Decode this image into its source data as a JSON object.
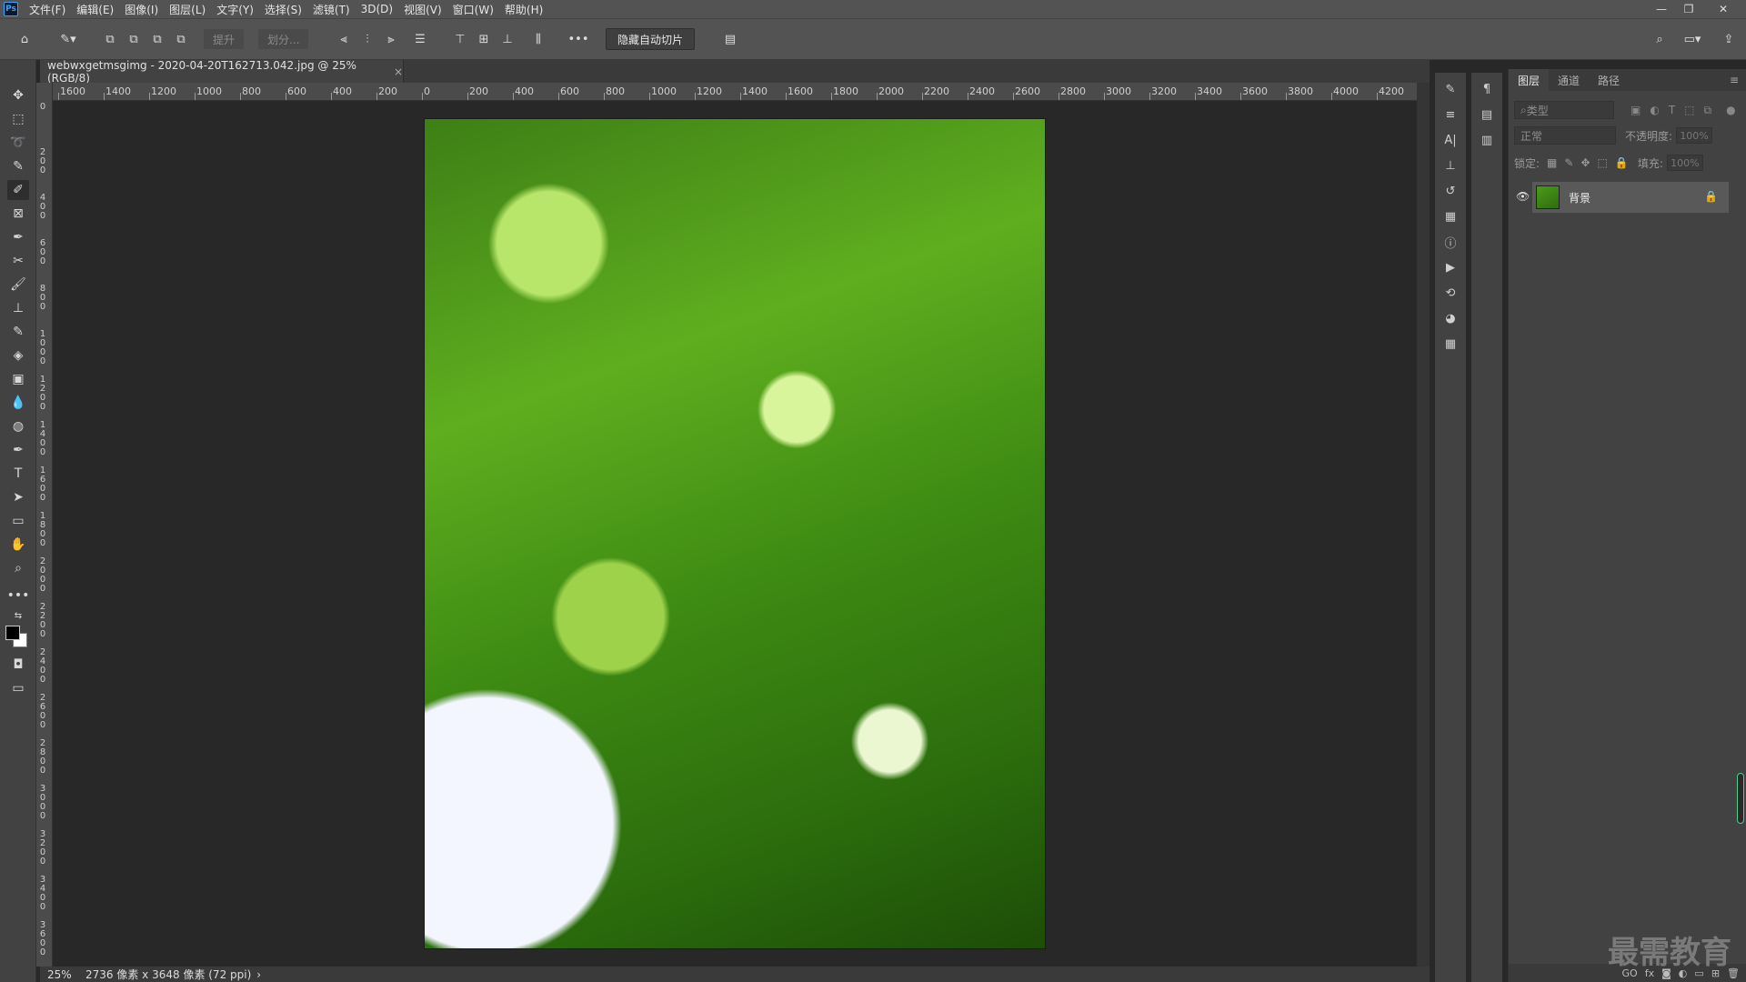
{
  "app": {
    "logo": "Ps"
  },
  "menu": [
    "文件(F)",
    "编辑(E)",
    "图像(I)",
    "图层(L)",
    "文字(Y)",
    "选择(S)",
    "滤镜(T)",
    "3D(D)",
    "视图(V)",
    "窗口(W)",
    "帮助(H)"
  ],
  "options_bar": {
    "lift_label": "提升",
    "divide_label": "划分...",
    "more_label": "•••",
    "hide_auto_slices_label": "隐藏自动切片"
  },
  "document": {
    "tab_title": "webwxgetmsgimg - 2020-04-20T162713.042.jpg @ 25%(RGB/8)",
    "close": "×"
  },
  "ruler": {
    "h_labels": [
      "1600",
      "1400",
      "1200",
      "1000",
      "800",
      "600",
      "400",
      "200",
      "0",
      "200",
      "400",
      "600",
      "800",
      "1000",
      "1200",
      "1400",
      "1600",
      "1800",
      "2000",
      "2200",
      "2400",
      "2600",
      "2800",
      "3000",
      "3200",
      "3400",
      "3600",
      "3800",
      "4000",
      "4200"
    ],
    "v_labels": [
      "0",
      "200",
      "400",
      "600",
      "800",
      "1000",
      "1200",
      "1400",
      "1600",
      "1800",
      "2000",
      "2200",
      "2400",
      "2600",
      "2800",
      "3000",
      "3200",
      "3400",
      "3600"
    ]
  },
  "status": {
    "zoom": "25%",
    "info": "2736 像素 x 3648 像素 (72 ppi)",
    "arrow": "›"
  },
  "layers_panel": {
    "tabs": [
      "图层",
      "通道",
      "路径"
    ],
    "filter_placeholder": "类型",
    "blend_mode": "正常",
    "opacity_label": "不透明度:",
    "opacity_value": "100%",
    "lock_label": "锁定:",
    "fill_label": "填充:",
    "fill_value": "100%",
    "layer_name": "背景",
    "bottom_icons": [
      "GO",
      "fx"
    ]
  },
  "watermark": "最需教育",
  "colors": {
    "accent": "#31a8ff",
    "foreground": "#000000",
    "background": "#ffffff"
  }
}
